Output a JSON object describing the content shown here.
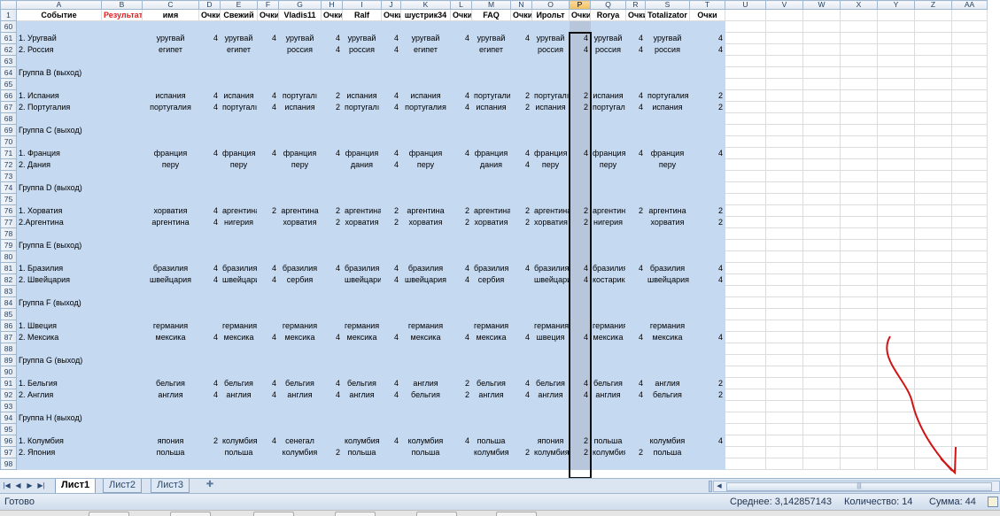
{
  "columns": [
    "A",
    "B",
    "C",
    "D",
    "E",
    "F",
    "G",
    "H",
    "I",
    "J",
    "K",
    "L",
    "M",
    "N",
    "O",
    "P",
    "Q",
    "R",
    "S",
    "T",
    "U",
    "V",
    "W",
    "X",
    "Y",
    "Z",
    "AA"
  ],
  "selected_column": "P",
  "header_row": {
    "num": "1",
    "cells": [
      "Событие",
      "Результат",
      "имя",
      "Очки",
      "Свежий",
      "Очки",
      "Vladis11",
      "Очки",
      "Ralf",
      "Очки",
      "шустрик34",
      "Очки",
      "FAQ",
      "Очки",
      "Ирольт",
      "Очки",
      "Rorya",
      "Очки",
      "Totalizator",
      "Очки",
      "",
      "",
      "",
      "",
      "",
      "",
      ""
    ]
  },
  "rows": [
    {
      "num": "60",
      "cells": []
    },
    {
      "num": "61",
      "cells": [
        "1. Уругвай",
        "",
        "уругвай",
        "4",
        "уругвай",
        "4",
        "уругвай",
        "4",
        "уругвай",
        "4",
        "уругвай",
        "4",
        "уругвай",
        "4",
        "уругвай",
        "4",
        "уругвай",
        "4",
        "уругвай",
        "4"
      ]
    },
    {
      "num": "62",
      "cells": [
        "2. Россия",
        "",
        "египет",
        "",
        "египет",
        "",
        "россия",
        "4",
        "россия",
        "4",
        "египет",
        "",
        "египет",
        "",
        "россия",
        "4",
        "россия",
        "4",
        "россия",
        "4"
      ]
    },
    {
      "num": "63",
      "cells": []
    },
    {
      "num": "64",
      "cells": [
        "Группа B (выход)"
      ]
    },
    {
      "num": "65",
      "cells": []
    },
    {
      "num": "66",
      "cells": [
        "1. Испания",
        "",
        "испания",
        "4",
        "испания",
        "4",
        "португалı",
        "2",
        "испания",
        "4",
        "испания",
        "4",
        "португалия",
        "2",
        "португалı",
        "2",
        "испания",
        "4",
        "португалия",
        "2"
      ]
    },
    {
      "num": "67",
      "cells": [
        "2. Португалия",
        "",
        "португалия",
        "4",
        "португалı",
        "4",
        "испания",
        "2",
        "португалı",
        "4",
        "португалия",
        "4",
        "испания",
        "2",
        "испания",
        "2",
        "португалия",
        "4",
        "испания",
        "2"
      ]
    },
    {
      "num": "68",
      "cells": []
    },
    {
      "num": "69",
      "cells": [
        "Группа C (выход)"
      ]
    },
    {
      "num": "70",
      "cells": []
    },
    {
      "num": "71",
      "cells": [
        "1. Франция",
        "",
        "франция",
        "4",
        "франция",
        "4",
        "франция",
        "4",
        "франция",
        "4",
        "франция",
        "4",
        "франция",
        "4",
        "франция",
        "4",
        "франция",
        "4",
        "франция",
        "4"
      ]
    },
    {
      "num": "72",
      "cells": [
        "2. Дания",
        "",
        "перу",
        "",
        "перу",
        "",
        "перу",
        "",
        "дания",
        "4",
        "перу",
        "",
        "дания",
        "4",
        "перу",
        "",
        "перу",
        "",
        "перу",
        ""
      ]
    },
    {
      "num": "73",
      "cells": []
    },
    {
      "num": "74",
      "cells": [
        "Группа D (выход)"
      ]
    },
    {
      "num": "75",
      "cells": []
    },
    {
      "num": "76",
      "cells": [
        "1. Хорватия",
        "",
        "хорватия",
        "4",
        "аргентина",
        "2",
        "аргентина",
        "2",
        "аргентина",
        "2",
        "аргентина",
        "2",
        "аргентина",
        "2",
        "аргентина",
        "2",
        "аргентина",
        "2",
        "аргентина",
        "2"
      ]
    },
    {
      "num": "77",
      "cells": [
        "2.Аргентина",
        "",
        "аргентина",
        "4",
        "нигерия",
        "",
        "хорватия",
        "2",
        "хорватия",
        "2",
        "хорватия",
        "2",
        "хорватия",
        "2",
        "хорватия",
        "2",
        "нигерия",
        "",
        "хорватия",
        "2"
      ]
    },
    {
      "num": "78",
      "cells": []
    },
    {
      "num": "79",
      "cells": [
        "Группа E (выход)"
      ]
    },
    {
      "num": "80",
      "cells": []
    },
    {
      "num": "81",
      "cells": [
        "1. Бразилия",
        "",
        "бразилия",
        "4",
        "бразилия",
        "4",
        "бразилия",
        "4",
        "бразилия",
        "4",
        "бразилия",
        "4",
        "бразилия",
        "4",
        "бразилия",
        "4",
        "бразилия",
        "4",
        "бразилия",
        "4"
      ]
    },
    {
      "num": "82",
      "cells": [
        "2. Швейцария",
        "",
        "швейцария",
        "4",
        "швейцари",
        "4",
        "сербия",
        "",
        "швейцари",
        "4",
        "швейцария",
        "4",
        "сербия",
        "",
        "швейцари",
        "4",
        "костарика",
        "",
        "швейцария",
        "4"
      ]
    },
    {
      "num": "83",
      "cells": []
    },
    {
      "num": "84",
      "cells": [
        "Группа F (выход)"
      ]
    },
    {
      "num": "85",
      "cells": []
    },
    {
      "num": "86",
      "cells": [
        "1. Швеция",
        "",
        "германия",
        "",
        "германия",
        "",
        "германия",
        "",
        "германия",
        "",
        "германия",
        "",
        "германия",
        "",
        "германия",
        "",
        "германия",
        "",
        "германия",
        ""
      ]
    },
    {
      "num": "87",
      "cells": [
        "2. Мексика",
        "",
        "мексика",
        "4",
        "мексика",
        "4",
        "мексика",
        "4",
        "мексика",
        "4",
        "мексика",
        "4",
        "мексика",
        "4",
        "швеция",
        "4",
        "мексика",
        "4",
        "мексика",
        "4"
      ]
    },
    {
      "num": "88",
      "cells": []
    },
    {
      "num": "89",
      "cells": [
        "Группа G (выход)"
      ]
    },
    {
      "num": "90",
      "cells": []
    },
    {
      "num": "91",
      "cells": [
        "1. Бельгия",
        "",
        "бельгия",
        "4",
        "бельгия",
        "4",
        "бельгия",
        "4",
        "бельгия",
        "4",
        "англия",
        "2",
        "бельгия",
        "4",
        "бельгия",
        "4",
        "бельгия",
        "4",
        "англия",
        "2"
      ]
    },
    {
      "num": "92",
      "cells": [
        "2. Англия",
        "",
        "англия",
        "4",
        "англия",
        "4",
        "англия",
        "4",
        "англия",
        "4",
        "бельгия",
        "2",
        "англия",
        "4",
        "англия",
        "4",
        "англия",
        "4",
        "бельгия",
        "2"
      ]
    },
    {
      "num": "93",
      "cells": []
    },
    {
      "num": "94",
      "cells": [
        "Группа H (выход)"
      ]
    },
    {
      "num": "95",
      "cells": []
    },
    {
      "num": "96",
      "cells": [
        "1. Колумбия",
        "",
        "япония",
        "2",
        "колумбия",
        "4",
        "сенегал",
        "",
        "колумбия",
        "4",
        "колумбия",
        "4",
        "польша",
        "",
        "япония",
        "2",
        "польша",
        "",
        "колумбия",
        "4"
      ]
    },
    {
      "num": "97",
      "cells": [
        "2. Япония",
        "",
        "польша",
        "",
        "польша",
        "",
        "колумбия",
        "2",
        "польша",
        "",
        "польша",
        "",
        "колумбия",
        "2",
        "колумбия",
        "2",
        "колумбия",
        "2",
        "польша",
        ""
      ]
    },
    {
      "num": "98",
      "cells": []
    }
  ],
  "sheet_tabs": [
    "Лист1",
    "Лист2",
    "Лист3"
  ],
  "active_sheet": "Лист1",
  "status": {
    "ready": "Готово",
    "average": "Среднее: 3,142857143",
    "count": "Количество: 14",
    "sum": "Сумма: 44"
  },
  "colors": {
    "fill": "#c5d9f1",
    "selected_column": "#b8c6db",
    "result_header": "#e41c1c",
    "annotation_arrow": "#d01414"
  }
}
